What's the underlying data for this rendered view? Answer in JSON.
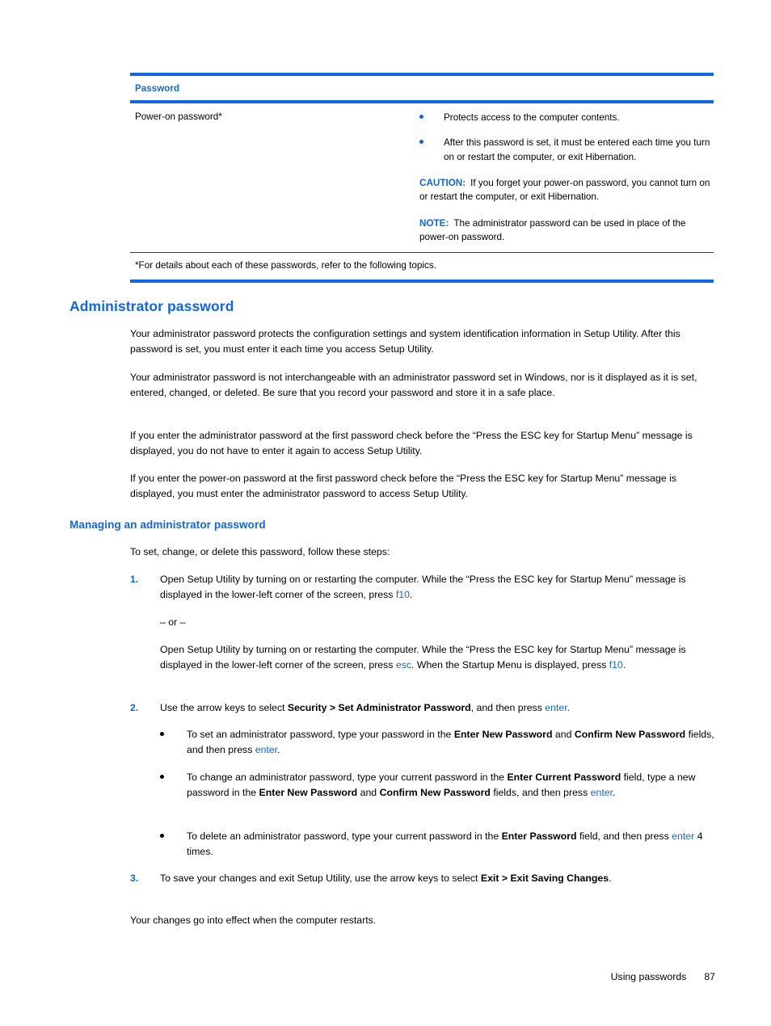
{
  "table": {
    "header": "Password",
    "row": {
      "label": "Power-on password*",
      "bullets": [
        "Protects access to the computer contents.",
        "After this password is set, it must be entered each time you turn on or restart the computer, or exit Hibernation."
      ],
      "caution_label": "CAUTION:",
      "caution_text": "If you forget your power-on password, you cannot turn on or restart the computer, or exit Hibernation.",
      "note_label": "NOTE:",
      "note_text": "The administrator password can be used in place of the power-on password."
    },
    "footnote": "*For details about each of these passwords, refer to the following topics."
  },
  "section": {
    "heading": "Administrator password",
    "paragraphs": [
      "Your administrator password protects the configuration settings and system identification information in Setup Utility. After this password is set, you must enter it each time you access Setup Utility.",
      "Your administrator password is not interchangeable with an administrator password set in Windows, nor is it displayed as it is set, entered, changed, or deleted. Be sure that you record your password and store it in a safe place.",
      "If you enter the administrator password at the first password check before the “Press the ESC key for Startup Menu” message is displayed, you do not have to enter it again to access Setup Utility.",
      "If you enter the power-on password at the first password check before the “Press the ESC key for Startup Menu” message is displayed, you must enter the administrator password to access Setup Utility."
    ]
  },
  "subsection": {
    "heading": "Managing an administrator password",
    "intro": "To set, change, or delete this password, follow these steps:",
    "step1": {
      "number": "1.",
      "text_a": "Open Setup Utility by turning on or restarting the computer. While the “Press the ESC key for Startup Menu” message is displayed in the lower-left corner of the screen, press ",
      "key_a": "f10",
      "text_b": "."
    },
    "or_divider": "– or –",
    "step1_alt": {
      "text_a": "Open Setup Utility by turning on or restarting the computer. While the “Press the ESC key for Startup Menu” message is displayed in the lower-left corner of the screen, press ",
      "key_a": "esc",
      "text_b": ". When the Startup Menu is displayed, press ",
      "key_b": "f10",
      "text_c": "."
    },
    "step2": {
      "number": "2.",
      "text_a": "Use the arrow keys to select ",
      "bold_a": "Security > Set Administrator Password",
      "text_b": ", and then press ",
      "key_a": "enter",
      "text_c": "."
    },
    "step2_bullets": [
      {
        "text_a": "To set an administrator password, type your password in the ",
        "bold_a": "Enter New Password",
        "text_b": " and ",
        "bold_b": "Confirm New Password",
        "text_c": " fields, and then press ",
        "key_a": "enter",
        "text_d": "."
      },
      {
        "text_a": "To change an administrator password, type your current password in the ",
        "bold_a": "Enter Current Password",
        "text_b": " field, type a new password in the ",
        "bold_b": "Enter New Password",
        "text_c": " and ",
        "bold_c": "Confirm New Password",
        "text_d": " fields, and then press ",
        "key_a": "enter",
        "text_e": "."
      },
      {
        "text_a": "To delete an administrator password, type your current password in the ",
        "bold_a": "Enter Password",
        "text_b": " field, and then press ",
        "key_a": "enter",
        "text_c": " 4 times."
      }
    ],
    "step3": {
      "number": "3.",
      "text_a": "To save your changes and exit Setup Utility, use the arrow keys to select ",
      "bold_a": "Exit > Exit Saving Changes",
      "text_b": "."
    },
    "closing": "Your changes go into effect when the computer restarts."
  },
  "footer": {
    "chapter": "Using passwords",
    "page": "87"
  },
  "colors": {
    "accent_blue": "#0f66e8",
    "text_black": "#000000"
  }
}
